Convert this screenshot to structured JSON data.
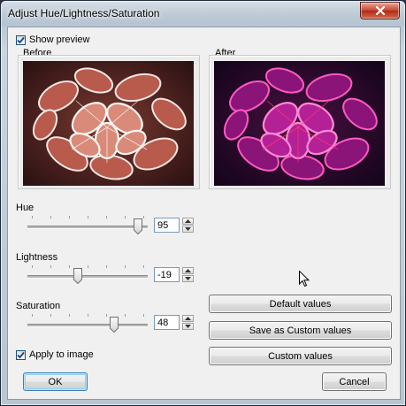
{
  "window": {
    "title": "Adjust Hue/Lightness/Saturation"
  },
  "preview": {
    "show_preview_label": "Show preview",
    "show_preview_checked": true,
    "before_label": "Before",
    "after_label": "After"
  },
  "sliders": {
    "hue": {
      "label": "Hue",
      "value": "95",
      "fraction": 0.95
    },
    "lightness": {
      "label": "Lightness",
      "value": "-19",
      "fraction": 0.41
    },
    "saturation": {
      "label": "Saturation",
      "value": "48",
      "fraction": 0.74
    }
  },
  "apply": {
    "label": "Apply to image",
    "checked": true
  },
  "buttons": {
    "default_values": "Default values",
    "save_custom": "Save as Custom values",
    "custom_values": "Custom values",
    "ok": "OK",
    "cancel": "Cancel"
  },
  "colors": {
    "before_bg": "#3a1a18",
    "before_leaf": "#c86a58",
    "before_frost": "#f2e4e0",
    "after_bg": "#1a0820",
    "after_leaf": "#b01f8e",
    "after_frost": "#ff6ac8",
    "accent": "#3c7fb1"
  },
  "icons": {
    "close": "close-x-icon",
    "check": "checkmark-icon",
    "spin_up": "arrow-up-icon",
    "spin_down": "arrow-down-icon",
    "cursor": "mouse-pointer-icon"
  }
}
